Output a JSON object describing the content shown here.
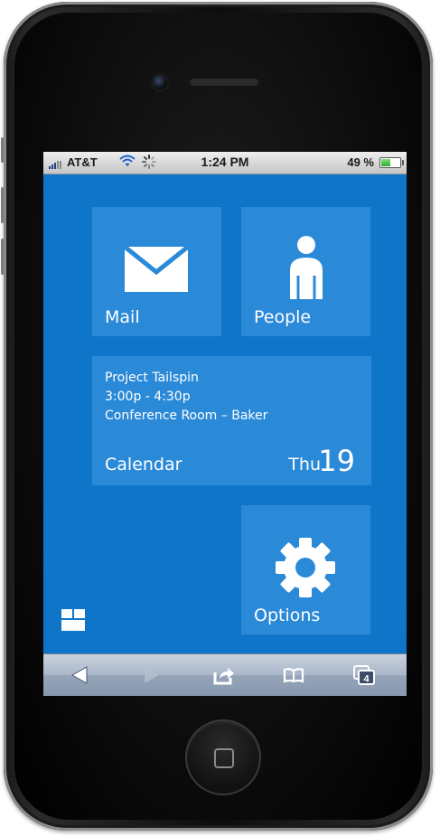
{
  "status_bar": {
    "carrier": "AT&T",
    "time": "1:24 PM",
    "battery_text": "49 %",
    "battery_level": 0.49,
    "icons": [
      "signal-bars-icon",
      "wifi-icon",
      "activity-spinner-icon",
      "battery-icon"
    ]
  },
  "tiles": {
    "mail": {
      "label": "Mail",
      "icon": "envelope-icon"
    },
    "people": {
      "label": "People",
      "icon": "person-icon"
    },
    "calendar": {
      "event_title": "Project Tailspin",
      "event_time": "3:00p - 4:30p",
      "event_location": "Conference Room – Baker",
      "label": "Calendar",
      "day": "Thu",
      "date": "19"
    },
    "options": {
      "label": "Options",
      "icon": "gear-icon"
    }
  },
  "layout_button": {
    "icon": "tile-layout-icon"
  },
  "toolbar": {
    "back_icon": "back-arrow-icon",
    "forward_icon": "forward-arrow-icon",
    "share_icon": "share-icon",
    "bookmarks_icon": "bookmarks-icon",
    "tabs_icon": "tabs-icon",
    "tabs_count": "4"
  },
  "colors": {
    "screen_background": "#0f75c9",
    "tile_background": "#2b8ad8",
    "tile_text": "#ffffff"
  }
}
